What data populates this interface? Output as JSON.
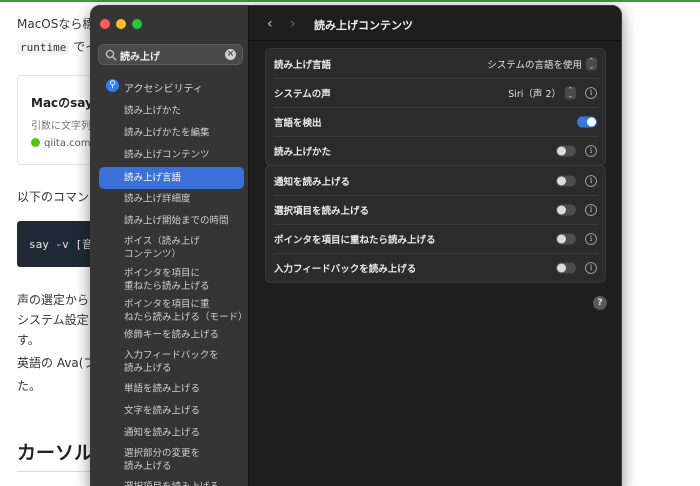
{
  "background_page": {
    "line1": "MacOSなら標",
    "line2_code": "runtime",
    "line2_text": "でイ",
    "card": {
      "title": "Macのsay",
      "description": "引数に文字列",
      "site": "qiita.com"
    },
    "intro": "以下のコマン",
    "code_block": "say -v [音",
    "para1": "声の選定から",
    "para2": "システム設定",
    "para3": "す。",
    "para4": "英語の Ava(ブ",
    "para5": "た。",
    "heading": "カーソル"
  },
  "window": {
    "title": "読み上げコンテンツ",
    "search": {
      "value": "読み上げ",
      "placeholder": "検索"
    },
    "sidebar": {
      "category": "アクセシビリティ",
      "items": [
        {
          "label": "読み上げかた"
        },
        {
          "label": "読み上げかたを編集"
        },
        {
          "label": "読み上げコンテンツ"
        },
        {
          "label": "読み上げ言語",
          "selected": true
        },
        {
          "label": "読み上げ詳細度"
        },
        {
          "label": "読み上げ開始までの時間"
        },
        {
          "label": "ボイス（読み上げ",
          "label2": "コンテンツ）"
        },
        {
          "label": "ポインタを項目に",
          "label2": "重ねたら読み上げる"
        },
        {
          "label": "ポインタを項目に重",
          "label2": "ねたら読み上げる（モード）"
        },
        {
          "label": "修飾キーを読み上げる"
        },
        {
          "label": "入力フィードバックを",
          "label2": "読み上げる"
        },
        {
          "label": "単語を読み上げる"
        },
        {
          "label": "文字を読み上げる"
        },
        {
          "label": "通知を読み上げる"
        },
        {
          "label": "選択部分の変更を",
          "label2": "読み上げる"
        },
        {
          "label": "選択項目を読み上げる"
        }
      ]
    },
    "group1": [
      {
        "label": "読み上げ言語",
        "value": "システムの言語を使用",
        "control": "popup"
      },
      {
        "label": "システムの声",
        "value": "Siri（声 2）",
        "control": "popup",
        "info": true
      },
      {
        "label": "言語を検出",
        "control": "toggle",
        "on": true
      },
      {
        "label": "読み上げかた",
        "control": "toggle",
        "on": false,
        "info": true
      }
    ],
    "group2": [
      {
        "label": "通知を読み上げる",
        "control": "toggle",
        "on": false,
        "info": true
      },
      {
        "label": "選択項目を読み上げる",
        "control": "toggle",
        "on": false,
        "info": true
      },
      {
        "label": "ポインタを項目に重ねたら読み上げる",
        "control": "toggle",
        "on": false,
        "info": true
      },
      {
        "label": "入力フィードバックを読み上げる",
        "control": "toggle",
        "on": false,
        "info": true
      }
    ],
    "help_label": "?",
    "back_glyph": "‹",
    "forward_glyph": "›",
    "info_glyph": "i",
    "clear_glyph": "×",
    "popup_glyph": "⌃⌄"
  }
}
